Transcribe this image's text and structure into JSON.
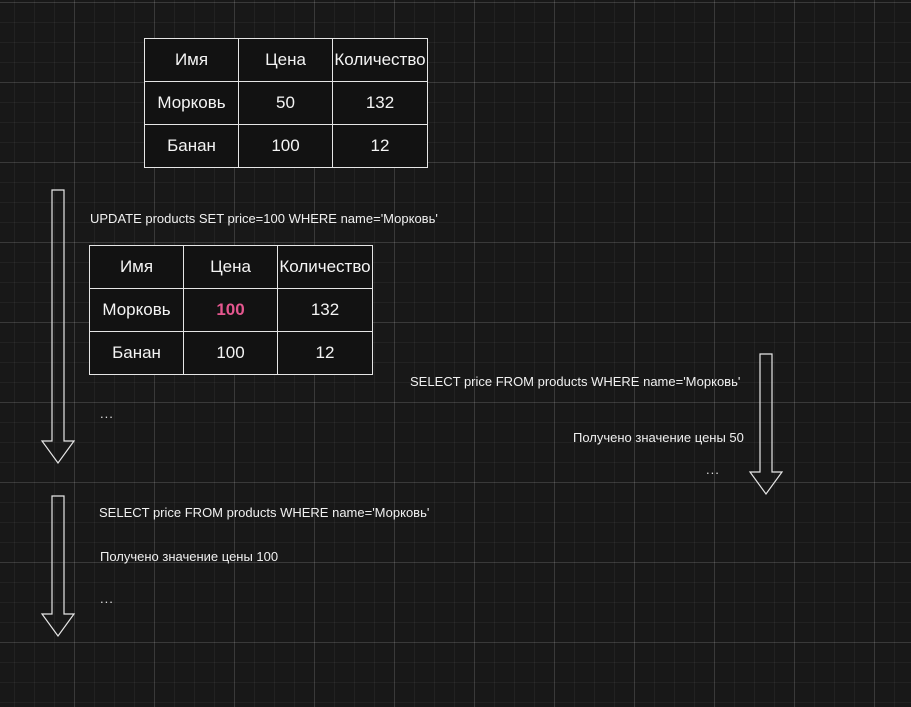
{
  "table_initial": {
    "headers": [
      "Имя",
      "Цена",
      "Количество"
    ],
    "rows": [
      [
        "Морковь",
        "50",
        "132"
      ],
      [
        "Банан",
        "100",
        "12"
      ]
    ]
  },
  "update_statement": "UPDATE products SET price=100 WHERE name='Морковь'",
  "table_updated": {
    "headers": [
      "Имя",
      "Цена",
      "Количество"
    ],
    "rows": [
      [
        "Морковь",
        "100",
        "132"
      ],
      [
        "Банан",
        "100",
        "12"
      ]
    ]
  },
  "transaction_left": {
    "ellipsis_1": "...",
    "select_statement": "SELECT price FROM products WHERE name='Морковь'",
    "result": "Получено значение цены 100",
    "ellipsis_2": "..."
  },
  "transaction_right": {
    "select_statement": "SELECT price FROM products WHERE name='Морковь'",
    "result": "Получено значение цены 50",
    "ellipsis": "..."
  },
  "colors": {
    "background": "#181818",
    "table_background": "#121212",
    "border": "#e6e6e6",
    "highlight": "#e5578f"
  }
}
